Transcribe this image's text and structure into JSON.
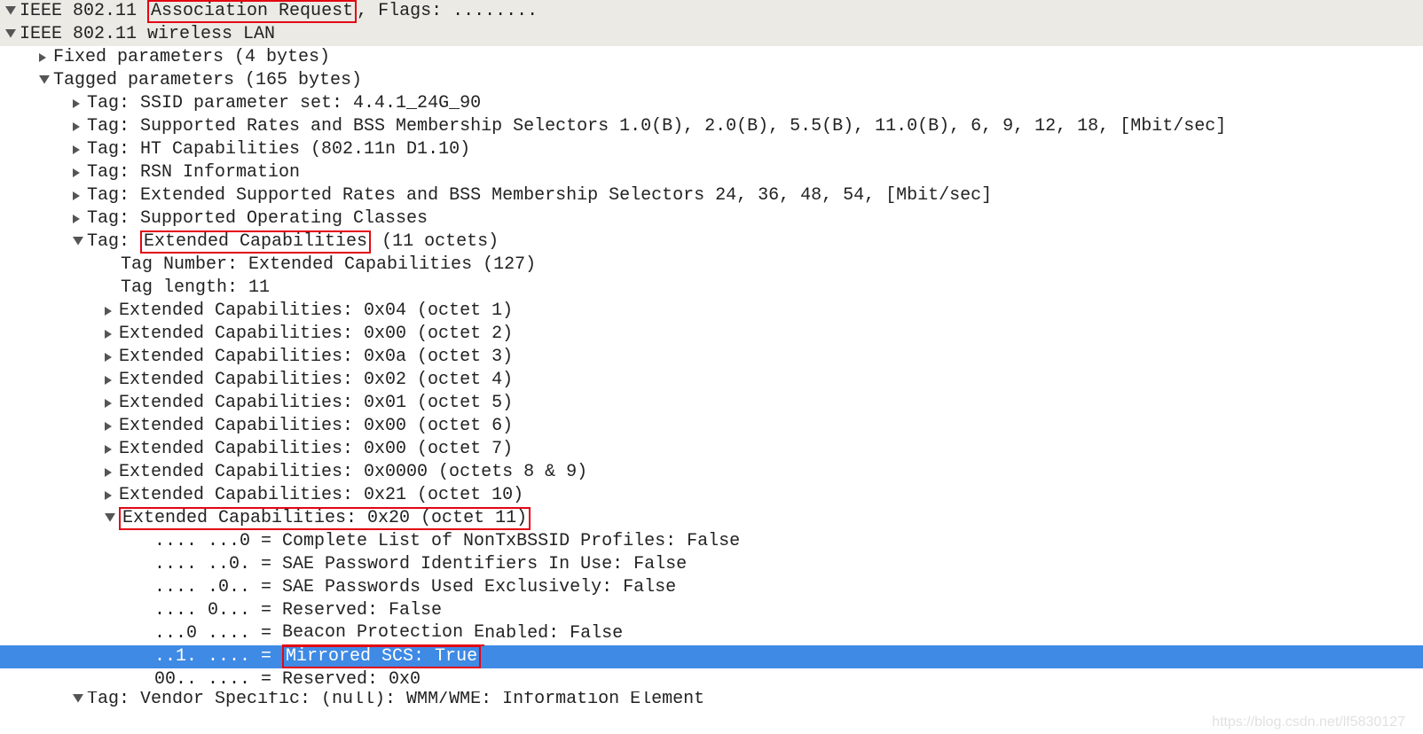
{
  "header": {
    "line1_prefix": "IEEE 802.11 ",
    "line1_box": "Association Request",
    "line1_suffix": ", Flags: ........",
    "line2": "IEEE 802.11 wireless LAN"
  },
  "fixed_params": "Fixed parameters (4 bytes)",
  "tagged_params": "Tagged parameters (165 bytes)",
  "tags": {
    "ssid": "Tag: SSID parameter set: 4.4.1_24G_90",
    "supported_rates": "Tag: Supported Rates and BSS Membership Selectors 1.0(B), 2.0(B), 5.5(B), 11.0(B), 6, 9, 12, 18, [Mbit/sec]",
    "ht": "Tag: HT Capabilities (802.11n D1.10)",
    "rsn": "Tag: RSN Information",
    "ext_rates": "Tag: Extended Supported Rates and BSS Membership Selectors 24, 36, 48, 54, [Mbit/sec]",
    "op_classes": "Tag: Supported Operating Classes",
    "ext_cap_prefix": "Tag: ",
    "ext_cap_box": "Extended Capabilities",
    "ext_cap_suffix": " (11 octets)",
    "tag_number": "Tag Number: Extended Capabilities (127)",
    "tag_length": "Tag length: 11",
    "octets": [
      "Extended Capabilities: 0x04 (octet 1)",
      "Extended Capabilities: 0x00 (octet 2)",
      "Extended Capabilities: 0x0a (octet 3)",
      "Extended Capabilities: 0x02 (octet 4)",
      "Extended Capabilities: 0x01 (octet 5)",
      "Extended Capabilities: 0x00 (octet 6)",
      "Extended Capabilities: 0x00 (octet 7)",
      "Extended Capabilities: 0x0000 (octets 8 & 9)",
      "Extended Capabilities: 0x21 (octet 10)"
    ],
    "octet11_box": "Extended Capabilities: 0x20 (octet 11)",
    "bits": {
      "b0": ".... ...0 = Complete List of NonTxBSSID Profiles: False",
      "b1": ".... ..0. = SAE Password Identifiers In Use: False",
      "b2": ".... .0.. = SAE Passwords Used Exclusively: False",
      "b3": ".... 0... = Reserved: False",
      "b4_prefix": "...0 .... = ",
      "b4_underline": "Beacon Protection E",
      "b4_suffix": "nabled: False",
      "b5_prefix": "..1. .... = ",
      "b5_box": "Mirrored SCS: True",
      "b6": "00.. .... = Reserved: 0x0"
    },
    "vendor": "Tag: Vendor Specific: (null): WMM/WME: Information Element"
  },
  "watermark": "https://blog.csdn.net/lf5830127"
}
